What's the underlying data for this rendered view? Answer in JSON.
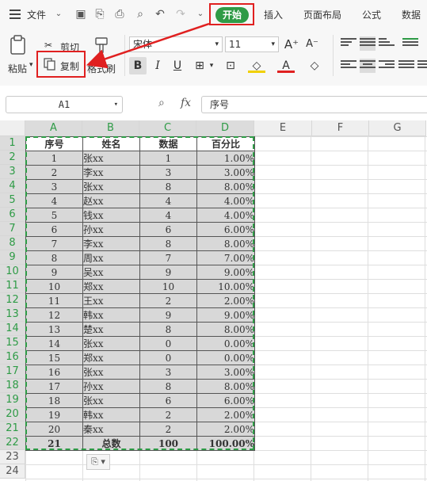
{
  "menu": {
    "file": "文件",
    "home": "开始",
    "insert": "插入",
    "layout": "页面布局",
    "formula": "公式",
    "data": "数据"
  },
  "ribbon": {
    "paste": "粘贴",
    "cut": "剪切",
    "copy": "复制",
    "format_painter": "格式刷",
    "font_name": "宋体",
    "font_size": "11"
  },
  "formula_bar": {
    "name_box": "A1",
    "fx": "fx",
    "content": "序号"
  },
  "columns": [
    "A",
    "B",
    "C",
    "D",
    "E",
    "F",
    "G"
  ],
  "rows": [
    "1",
    "2",
    "3",
    "4",
    "5",
    "6",
    "7",
    "8",
    "9",
    "10",
    "11",
    "12",
    "13",
    "14",
    "15",
    "16",
    "17",
    "18",
    "19",
    "20",
    "21",
    "22",
    "23",
    "24"
  ],
  "table": {
    "headers": [
      "序号",
      "姓名",
      "数据",
      "百分比"
    ],
    "rows": [
      [
        "1",
        "张xx",
        "1",
        "1.00%"
      ],
      [
        "2",
        "李xx",
        "3",
        "3.00%"
      ],
      [
        "3",
        "张xx",
        "8",
        "8.00%"
      ],
      [
        "4",
        "赵xx",
        "4",
        "4.00%"
      ],
      [
        "5",
        "钱xx",
        "4",
        "4.00%"
      ],
      [
        "6",
        "孙xx",
        "6",
        "6.00%"
      ],
      [
        "7",
        "李xx",
        "8",
        "8.00%"
      ],
      [
        "8",
        "周xx",
        "7",
        "7.00%"
      ],
      [
        "9",
        "吴xx",
        "9",
        "9.00%"
      ],
      [
        "10",
        "郑xx",
        "10",
        "10.00%"
      ],
      [
        "11",
        "王xx",
        "2",
        "2.00%"
      ],
      [
        "12",
        "韩xx",
        "9",
        "9.00%"
      ],
      [
        "13",
        "楚xx",
        "8",
        "8.00%"
      ],
      [
        "14",
        "张xx",
        "0",
        "0.00%"
      ],
      [
        "15",
        "郑xx",
        "0",
        "0.00%"
      ],
      [
        "16",
        "张xx",
        "3",
        "3.00%"
      ],
      [
        "17",
        "孙xx",
        "8",
        "8.00%"
      ],
      [
        "18",
        "张xx",
        "6",
        "6.00%"
      ],
      [
        "19",
        "韩xx",
        "2",
        "2.00%"
      ],
      [
        "20",
        "秦xx",
        "2",
        "2.00%"
      ]
    ],
    "total": [
      "21",
      "总数",
      "100",
      "100.00%"
    ]
  },
  "colors": {
    "accent": "#2e9b46",
    "highlight": "#e02020",
    "cell_fill": "#d8d8d8"
  }
}
